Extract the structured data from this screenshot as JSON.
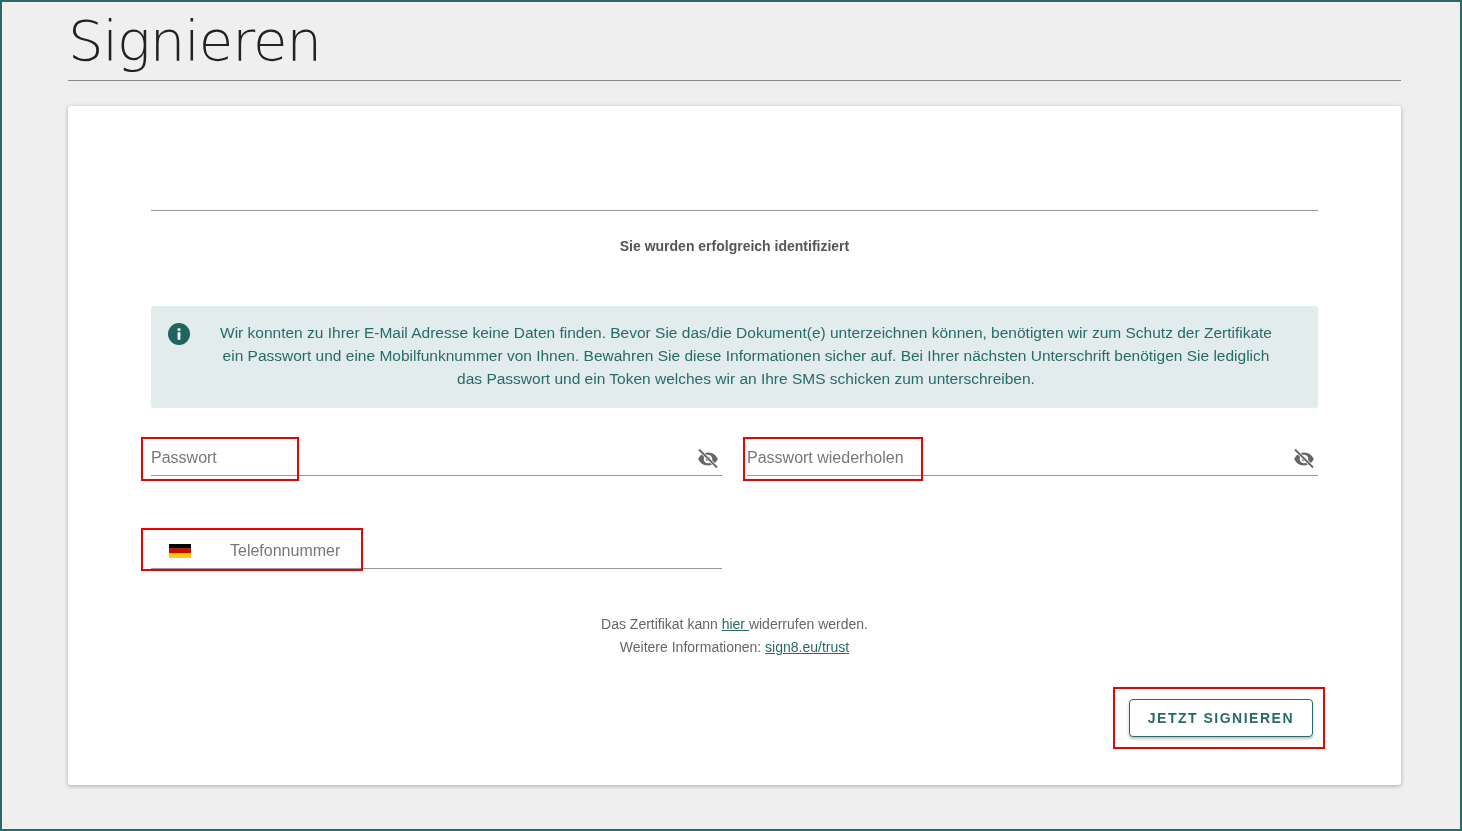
{
  "page_title": "Signieren",
  "status_text": "Sie wurden erfolgreich identifiziert",
  "info_message": "Wir konnten zu Ihrer E-Mail Adresse keine Daten finden. Bevor Sie das/die Dokument(e) unterzeichnen können, benötigten wir zum Schutz der Zertifikate ein Passwort und eine Mobilfunknummer von Ihnen. Bewahren Sie diese Informationen sicher auf. Bei Ihrer nächsten Unterschrift benötigen Sie lediglich das Passwort und ein Token welches wir an Ihre SMS schicken zum unterschreiben.",
  "fields": [
    {
      "kind": "password",
      "placeholder": "Passwort",
      "highlighted": true
    },
    {
      "kind": "password",
      "placeholder": "Passwort wiederholen",
      "highlighted": true
    },
    {
      "kind": "phone",
      "placeholder": "Telefonnummer",
      "highlighted": true
    }
  ],
  "footer": [
    {
      "before": "Das Zertifikat kann ",
      "link": "hier ",
      "after": "widerrufen werden."
    },
    {
      "before": "Weitere Informationen: ",
      "link": "sign8.eu/trust"
    }
  ],
  "submit_button": {
    "label": "JETZT SIGNIEREN",
    "highlighted": true
  }
}
